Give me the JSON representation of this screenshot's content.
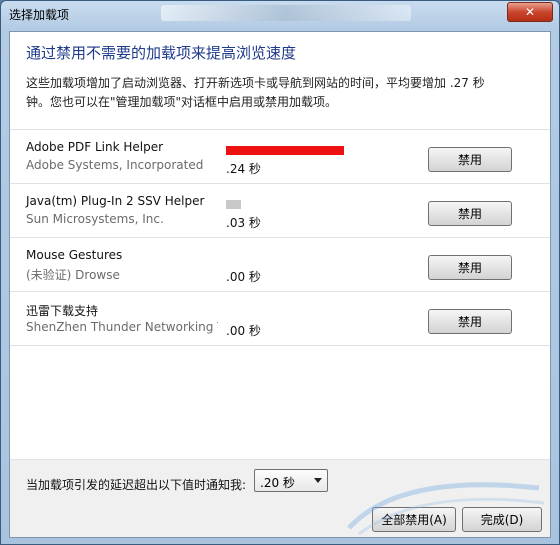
{
  "window": {
    "title": "选择加载项",
    "close_label": "✕"
  },
  "main": {
    "heading": "通过禁用不需要的加载项来提高浏览速度",
    "description": "这些加载项增加了启动浏览器、打开新选项卡或导航到网站的时间，平均要增加 .27 秒钟。您也可以在\"管理加载项\"对话框中启用或禁用加载项。"
  },
  "addons": [
    {
      "name": "Adobe PDF Link Helper",
      "publisher": "Adobe Systems, Incorporated",
      "time": ".24 秒",
      "load_fraction": 1.0,
      "bar_color": "#ee1111",
      "button_label": "禁用"
    },
    {
      "name": "Java(tm) Plug-In 2 SSV Helper",
      "publisher": "Sun Microsystems, Inc.",
      "time": ".03 秒",
      "load_fraction": 0.125,
      "bar_color": "#c8c8c8",
      "button_label": "禁用"
    },
    {
      "name": "Mouse Gestures",
      "publisher": "(未验证) Drowse",
      "time": ".00 秒",
      "load_fraction": 0,
      "bar_color": "#c8c8c8",
      "button_label": "禁用"
    },
    {
      "name": "迅雷下载支持",
      "publisher": "ShenZhen Thunder Networking T",
      "time": ".00 秒",
      "load_fraction": 0,
      "bar_color": "#c8c8c8",
      "button_label": "禁用"
    }
  ],
  "footer": {
    "notify_label": "当加载项引发的延迟超出以下值时通知我:",
    "threshold_value": ".20 秒",
    "disable_all_label": "全部禁用(A)",
    "done_label": "完成(D)"
  }
}
